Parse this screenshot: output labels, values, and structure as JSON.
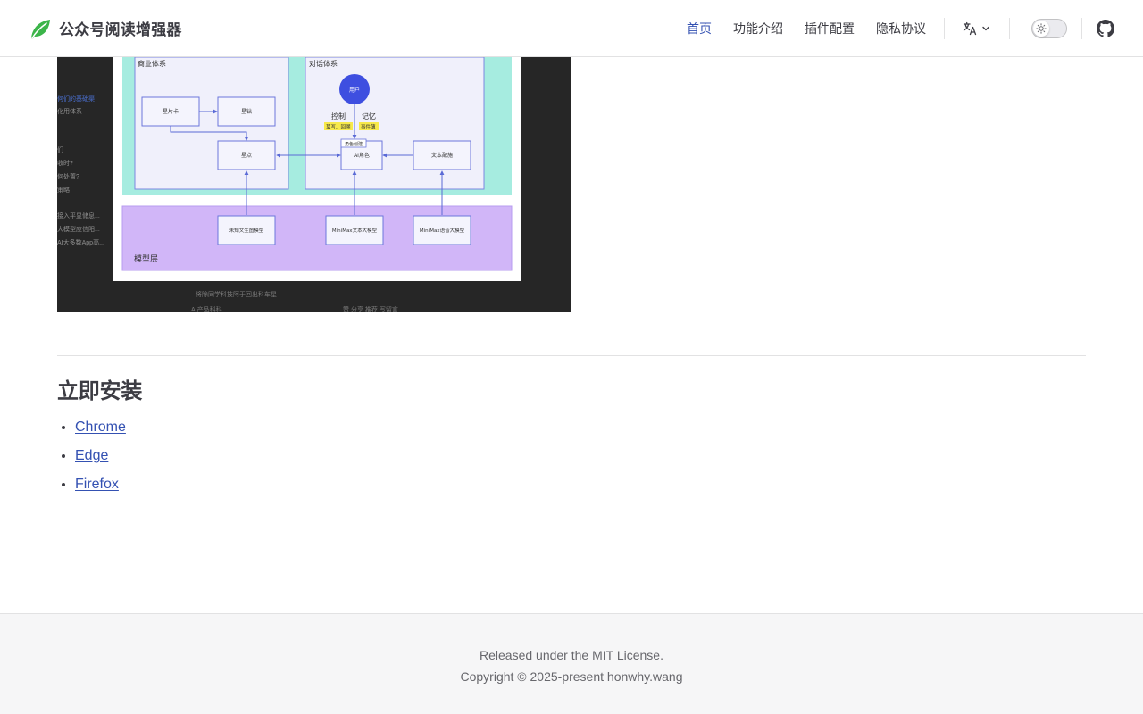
{
  "site": {
    "title": "公众号阅读增强器",
    "brand_color": "#3cb54a"
  },
  "nav": {
    "links": [
      {
        "label": "首页",
        "active": true
      },
      {
        "label": "功能介绍",
        "active": false
      },
      {
        "label": "插件配置",
        "active": false
      },
      {
        "label": "隐私协议",
        "active": false
      }
    ],
    "language_icon": "translate-icon",
    "theme_icon": "sun-icon",
    "social_icon": "github-icon",
    "accent_color": "#3451b2"
  },
  "diagram": {
    "business_label": "商业体系",
    "dialogue_label": "对话体系",
    "user_label": "用户",
    "control_label": "控制",
    "memory_label": "记忆",
    "control_sub": "莫写、回溯",
    "memory_sub": "事件薄",
    "role_create_label": "角色创建",
    "star_card": "星片卡",
    "star_drill": "星钻",
    "star_point": "星点",
    "ai_role": "AI角色",
    "text_match": "文本配施",
    "model_layer_label": "模型层",
    "model_unknown": "未知文生图模型",
    "model_minimax_text": "MiniMax文本大模型",
    "model_minimax_voice": "MiniMax语音大模型",
    "side_texts": [
      "何们的基础渠",
      "化用体系",
      "们",
      "收时?",
      "何处置?",
      "策略",
      "接入平显储息...",
      "大模型应信阳...",
      "AI大多数App高..."
    ],
    "footer_caption": "将除同学科技阿于回出科车星",
    "footer_author": "AI产品科科",
    "footer_actions": "赞  分享  推荐  写留言"
  },
  "install": {
    "title": "立即安装",
    "links": [
      "Chrome",
      "Edge",
      "Firefox"
    ]
  },
  "footer": {
    "license": "Released under the MIT License.",
    "copyright": "Copyright © 2025-present honwhy.wang"
  }
}
